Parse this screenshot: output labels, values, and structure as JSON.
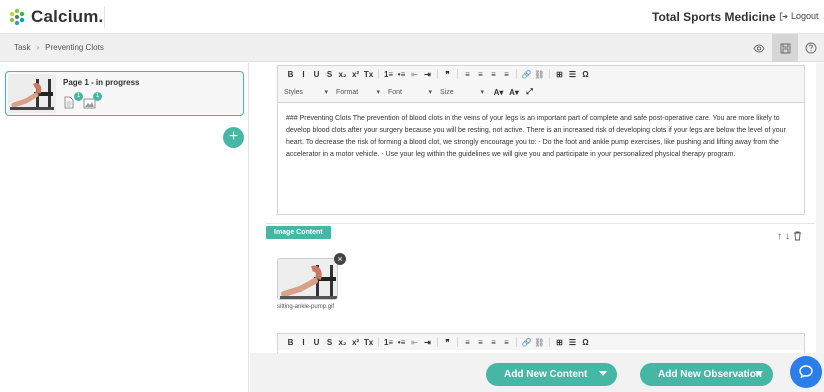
{
  "app": {
    "logo_text": "Calcium.",
    "org_name": "Total Sports Medicine",
    "logout_label": "Logout"
  },
  "breadcrumb": {
    "items": [
      "Task",
      "Preventing Clots"
    ]
  },
  "sidebar": {
    "page_card": {
      "title": "Page 1 - in progress",
      "text_count": "1",
      "image_count": "1"
    },
    "add_button": "+"
  },
  "editor": {
    "toolbar_row1": [
      "B",
      "I",
      "U",
      "S",
      "x₂",
      "x²",
      "Tx",
      "1≡",
      "•≡",
      "⇤",
      "⇥",
      "❞",
      "≡",
      "≡",
      "≡",
      "≡",
      "🔗",
      "⛓",
      "⊞",
      "☰",
      "Ω"
    ],
    "toolbar_selects": [
      "Styles",
      "Format",
      "Font",
      "Size"
    ],
    "body_text": "### Preventing Clots The prevention of blood clots in the veins of your legs is an important part of complete and safe post-operative care. You are more likely to develop blood clots after your surgery because you will be resting, not active. There is an increased risk of developing clots if your legs are below the level of your heart. To decrease the risk of forming a blood clot, we strongly encourage you to: - Do the foot and ankle pump exercises, like pushing and lifting away from the accelerator in a motor vehicle. - Use your leg within the guidelines we will give you and participate in your personalized physical therapy program."
  },
  "image_section": {
    "tag": "Image Content",
    "remove_label": "×",
    "caption": "sitting-ankle-pump.gif",
    "actions": [
      "↑",
      "↓"
    ]
  },
  "bottom": {
    "add_content": "Add New Content",
    "add_observation": "Add New Observation"
  },
  "colors": {
    "accent": "#45b7a4",
    "chat": "#2b7de9"
  }
}
